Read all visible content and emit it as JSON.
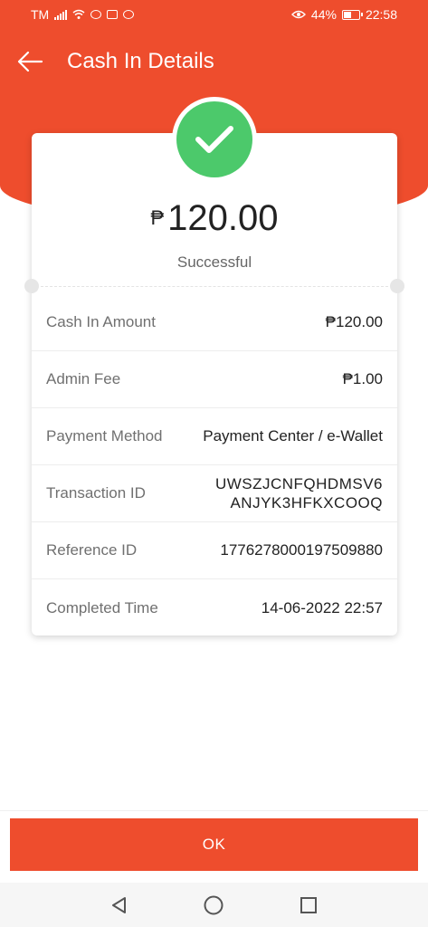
{
  "status_bar": {
    "carrier": "TM",
    "battery": "44%",
    "time": "22:58"
  },
  "header": {
    "title": "Cash In Details"
  },
  "summary": {
    "currency_symbol": "₱",
    "amount": "120.00",
    "status": "Successful"
  },
  "details": [
    {
      "label": "Cash In Amount",
      "value": "₱120.00"
    },
    {
      "label": "Admin Fee",
      "value": "₱1.00"
    },
    {
      "label": "Payment Method",
      "value": "Payment Center / e-Wallet"
    },
    {
      "label": "Transaction ID",
      "value_line1": "UWSZJCNFQHDMSV6",
      "value_line2": "ANJYK3HFKXCOOQ"
    },
    {
      "label": "Reference ID",
      "value": "1776278000197509880"
    },
    {
      "label": "Completed Time",
      "value": "14-06-2022 22:57"
    }
  ],
  "footer": {
    "ok_label": "OK"
  },
  "colors": {
    "brand": "#ee4d2d",
    "success": "#4cc96b"
  },
  "icons": {
    "back": "arrow-left-icon",
    "success": "check-icon",
    "nav_back": "triangle-back-icon",
    "nav_home": "circle-home-icon",
    "nav_recents": "square-recents-icon"
  }
}
